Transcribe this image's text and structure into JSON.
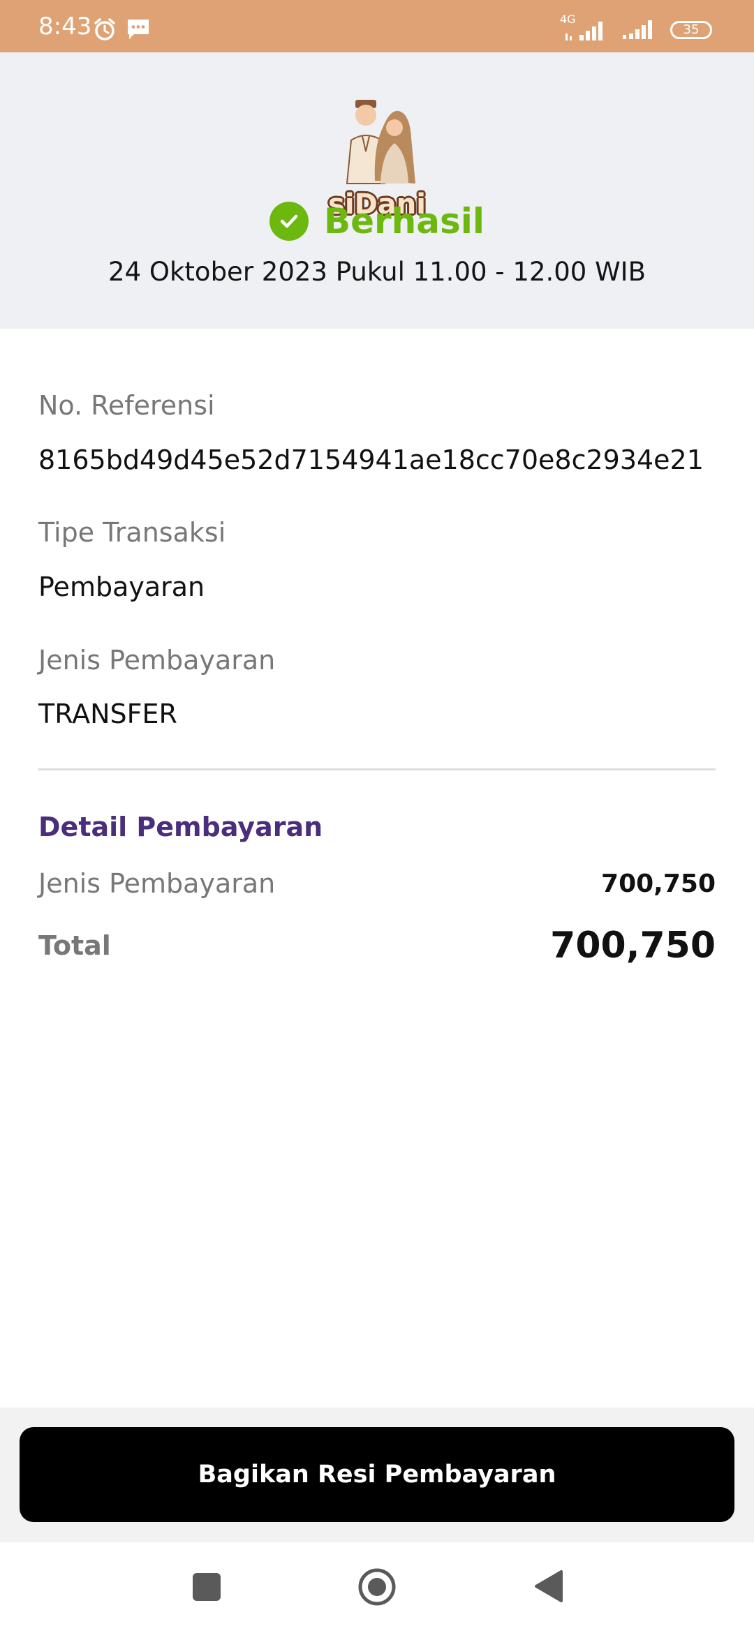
{
  "status_bar": {
    "time": "8:43",
    "network": "4G",
    "battery": "35",
    "icons": [
      "alarm-icon",
      "message-icon",
      "signal-icon",
      "signal-icon",
      "battery-icon"
    ]
  },
  "header": {
    "logo_text": "siDani",
    "status": "Berhasil",
    "datetime": "24 Oktober 2023 Pukul 11.00 - 12.00 WIB"
  },
  "details": {
    "reference_label": "No. Referensi",
    "reference_value": "8165bd49d45e52d7154941ae18cc70e8c2934e21",
    "type_label": "Tipe Transaksi",
    "type_value": "Pembayaran",
    "method_label": "Jenis Pembayaran",
    "method_value": "TRANSFER"
  },
  "payment_detail": {
    "title": "Detail Pembayaran",
    "rows": [
      {
        "label": "Jenis Pembayaran",
        "value": "700,750"
      },
      {
        "label": "Total",
        "value": "700,750"
      }
    ]
  },
  "actions": {
    "share_label": "Bagikan Resi Pembayaran"
  },
  "colors": {
    "status_bar": "#DFA275",
    "success": "#6DB80F",
    "accent": "#4A2E7C",
    "button": "#000000"
  }
}
